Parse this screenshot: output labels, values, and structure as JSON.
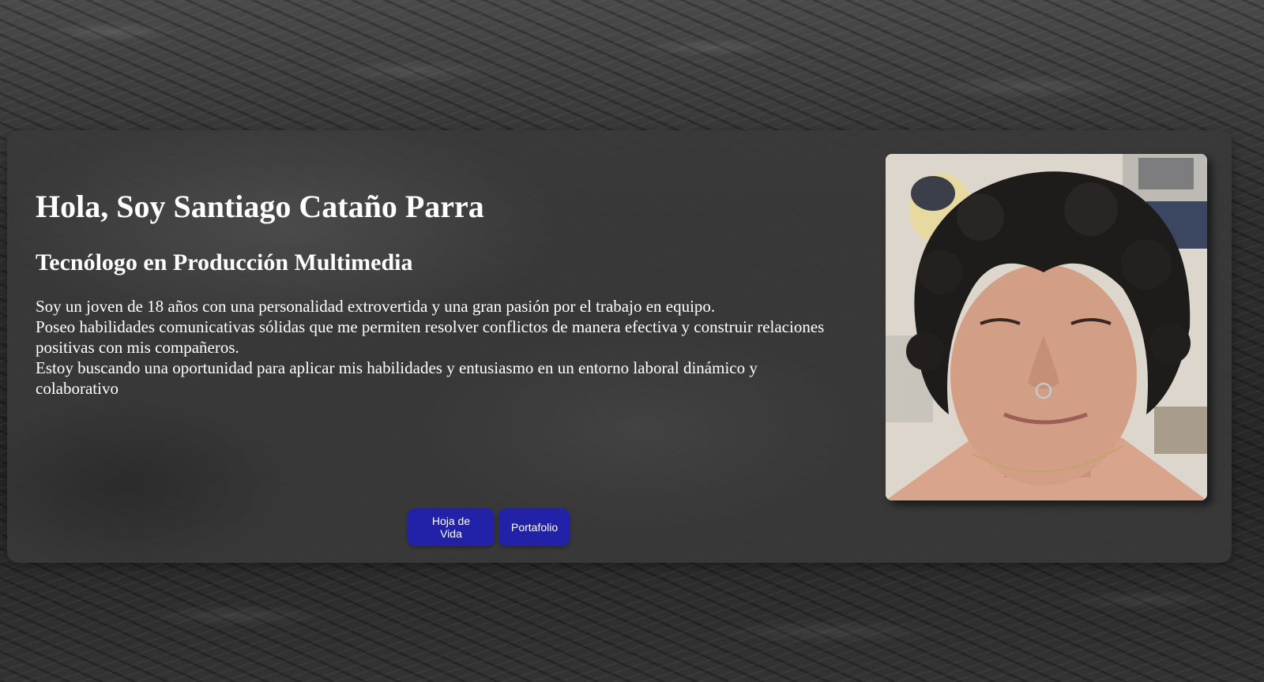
{
  "profile": {
    "greeting": "Hola, Soy Santiago Cataño Parra",
    "role": "Tecnólogo en Producción Multimedia",
    "about": [
      "Soy un joven de 18 años con una personalidad extrovertida y una gran pasión por el trabajo en equipo.",
      "Poseo habilidades comunicativas sólidas que me permiten resolver conflictos de manera efectiva y construir relaciones positivas con mis compañeros.",
      "Estoy buscando una oportunidad para aplicar mis habilidades y entusiasmo en un entorno laboral dinámico y colaborativo"
    ]
  },
  "actions": {
    "cv_label": "Hoja de Vida",
    "portfolio_label": "Portafolio"
  },
  "colors": {
    "button_bg": "#2222a8",
    "text": "#ffffff",
    "card_bg": "#3a3a3a"
  }
}
